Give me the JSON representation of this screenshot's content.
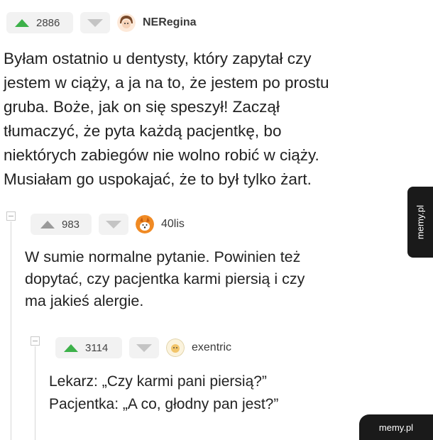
{
  "colors": {
    "upvote": "#3db14a",
    "upvote_muted": "#9a9a9a",
    "downvote": "#c4c4c4",
    "watermark_bg": "#1a1a1a"
  },
  "comments": [
    {
      "score": "2886",
      "username": "NERegina",
      "avatar": "girl-avatar",
      "text": "Byłam ostatnio u dentysty, który zapytał czy\njestem w ciąży, a ja na to, że jestem po prostu\ngruba. Boże, jak on się speszył! Zaczął\ntłumaczyć, że pyta każdą pacjentkę, bo\nniektórych zabiegów nie wolno robić w ciąży.\nMusiałam go uspokajać, że to był tylko żart."
    },
    {
      "score": "983",
      "username": "40lis",
      "avatar": "fox-avatar",
      "text": "W sumie normalne pytanie. Powinien też\ndopytać, czy pacjentka karmi piersią i czy\nma jakieś alergie."
    },
    {
      "score": "3114",
      "username": "exentric",
      "avatar": "default-avatar",
      "text": "Lekarz: „Czy karmi pani piersią?”\nPacjentka: „A co, głodny pan jest?”"
    }
  ],
  "watermark": {
    "side": "memy.pl",
    "corner": "memy.pl"
  }
}
